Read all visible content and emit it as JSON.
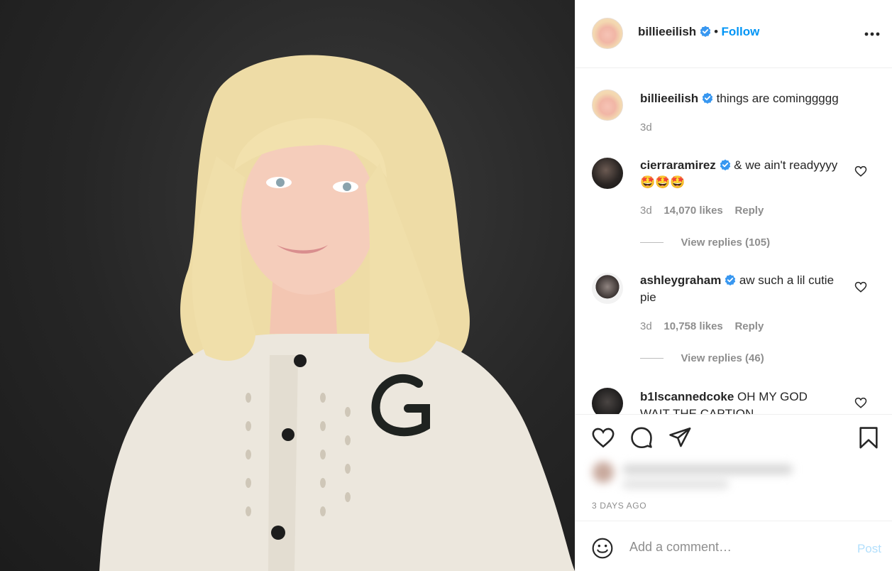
{
  "post": {
    "image_alt": "Photo of person with blonde hair wearing a cream cardigan",
    "author": "billieeilish",
    "follow_label": "Follow",
    "separator": "•"
  },
  "caption": {
    "username": "billieeilish",
    "text": "things are cominggggg",
    "time": "3d"
  },
  "comments": [
    {
      "username": "cierraramirez",
      "text": "& we ain't readyyyy🤩🤩🤩",
      "time": "3d",
      "likes": "14,070 likes",
      "reply": "Reply",
      "view_replies": "View replies (105)"
    },
    {
      "username": "ashleygraham",
      "text": "aw such a lil cutie pie",
      "time": "3d",
      "likes": "10,758 likes",
      "reply": "Reply",
      "view_replies": "View replies (46)"
    },
    {
      "username": "b1lscannedcoke",
      "text": "OH MY GOD WAIT THE CAPTION"
    }
  ],
  "footer": {
    "date": "3 DAYS AGO",
    "comment_placeholder": "Add a comment…",
    "post_label": "Post"
  },
  "colors": {
    "link_blue": "#0095f6",
    "verified_blue": "#3897f0",
    "muted": "#8e8e8e",
    "post_disabled": "#b2dffc"
  },
  "icons": [
    "more-options-icon",
    "verified-icon",
    "heart-icon",
    "comment-icon",
    "share-icon",
    "bookmark-icon",
    "emoji-icon"
  ]
}
